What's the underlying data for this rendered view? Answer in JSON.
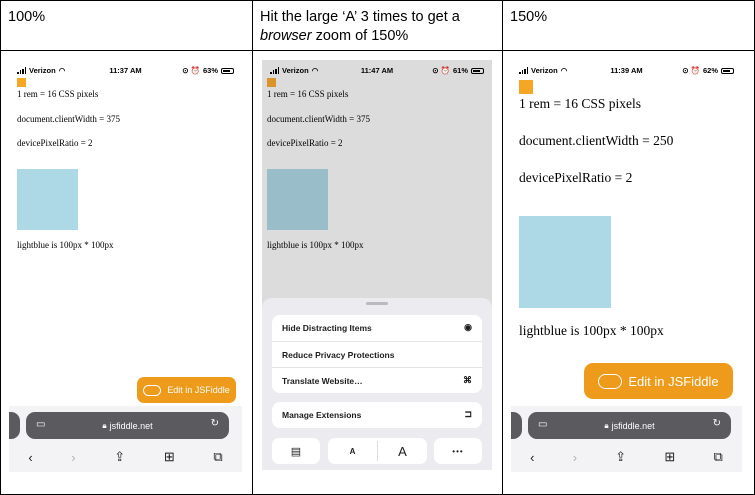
{
  "columns": [
    {
      "title": "100%"
    },
    {
      "title_line1": "Hit the large ‘A’ 3 times to get a",
      "title_line2_em": "browser",
      "title_line2_rest": " zoom of 150%"
    },
    {
      "title": "150%"
    }
  ],
  "phones": [
    {
      "carrier": "Verizon",
      "time": "11:37 AM",
      "battery": "63%",
      "rem_text": "1 rem = 16 CSS pixels",
      "client_width_text": "document.clientWidth = 375",
      "dpr_text": "devicePixelRatio = 2",
      "lightblue_text": "lightblue is 100px * 100px",
      "edit_button": "Edit in JSFiddle",
      "url": "jsfiddle.net"
    },
    {
      "carrier": "Verizon",
      "time": "11:47 AM",
      "battery": "61%",
      "rem_text": "1 rem = 16 CSS pixels",
      "client_width_text": "document.clientWidth = 375",
      "dpr_text": "devicePixelRatio = 2",
      "lightblue_text": "lightblue is 100px * 100px",
      "menu": {
        "items_group1": [
          {
            "label": "Hide Distracting Items",
            "icon": "eye-slash-icon"
          },
          {
            "label": "Reduce Privacy Protections",
            "icon": ""
          },
          {
            "label": "Translate Website…",
            "icon": "translate-icon"
          }
        ],
        "items_group2": [
          {
            "label": "Manage Extensions",
            "icon": "extensions-icon"
          }
        ],
        "small_a": "A",
        "large_a": "A",
        "more": "•••"
      }
    },
    {
      "carrier": "Verizon",
      "time": "11:39 AM",
      "battery": "62%",
      "rem_text": "1 rem = 16 CSS pixels",
      "client_width_text": "document.clientWidth = 250",
      "dpr_text": "devicePixelRatio = 2",
      "lightblue_text": "lightblue is 100px * 100px",
      "edit_button": "Edit in JSFiddle",
      "url": "jsfiddle.net"
    }
  ],
  "colors": {
    "orange": "#f5a623",
    "lightblue": "#add8e6",
    "jsfiddle_button": "#ee9a1a",
    "dim_overlay": "#dcdcdc"
  }
}
